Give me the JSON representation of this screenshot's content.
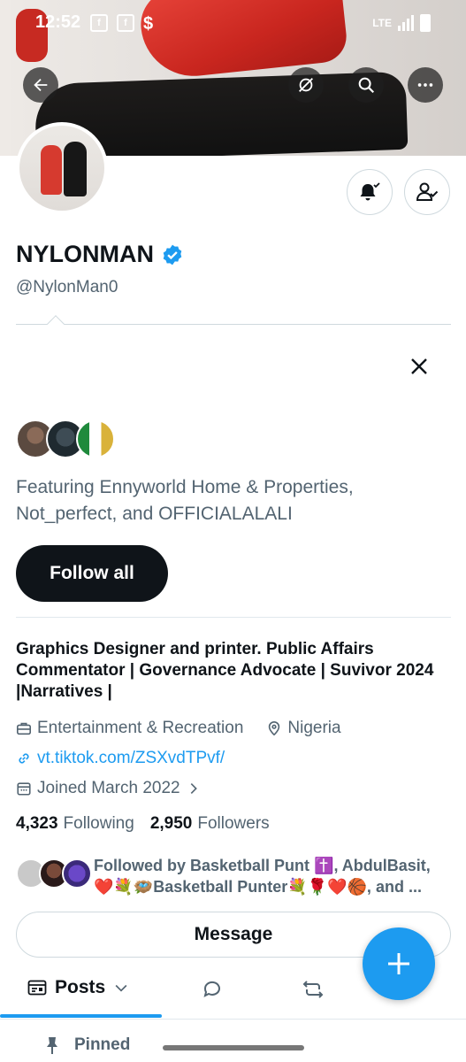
{
  "status_bar": {
    "time": "12:52",
    "network": "LTE"
  },
  "profile": {
    "name": "NYLONMAN",
    "handle": "@NylonMan0",
    "bio": "Graphics Designer and printer. Public Affairs Commentator | Governance Advocate | Suvivor 2024 |Narratives |",
    "category": "Entertainment & Recreation",
    "location": "Nigeria",
    "website": "vt.tiktok.com/ZSXvdTPvf/",
    "joined": "Joined March 2022",
    "following_count": "4,323",
    "following_label": "Following",
    "followers_count": "2,950",
    "followers_label": "Followers",
    "followed_by": "Followed by Basketball Punt ✝️, AbdulBasit, ❤️💐🪺Basketball Punter💐🌹❤️🏀, and ..."
  },
  "suggestions": {
    "featuring": "Featuring Ennyworld Home & Properties, Not_perfect, and OFFICIALALALI",
    "follow_all_label": "Follow all"
  },
  "actions": {
    "message_label": "Message"
  },
  "tabs": {
    "posts_label": "Posts"
  },
  "pinned_label": "Pinned",
  "colors": {
    "accent": "#1d9bf0",
    "text": "#0f1419",
    "muted": "#536471"
  }
}
